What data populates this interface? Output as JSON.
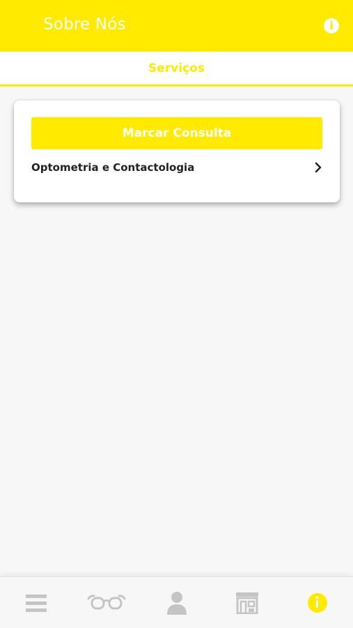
{
  "header": {
    "title": "Sobre Nós"
  },
  "tabs": [
    {
      "label": "Serviços",
      "active": true
    }
  ],
  "card": {
    "primary_button_label": "Marcar Consulta",
    "services": [
      {
        "label": "Optometria e Contactologia"
      }
    ]
  },
  "bottom_nav": {
    "items": [
      {
        "icon": "menu-icon"
      },
      {
        "icon": "glasses-icon"
      },
      {
        "icon": "user-icon"
      },
      {
        "icon": "store-icon"
      },
      {
        "icon": "info-icon",
        "active": true
      }
    ]
  },
  "colors": {
    "accent": "#ffea00",
    "inactive_icon": "#c4c4c4",
    "background": "#f7f7f7",
    "text": "#222222"
  }
}
